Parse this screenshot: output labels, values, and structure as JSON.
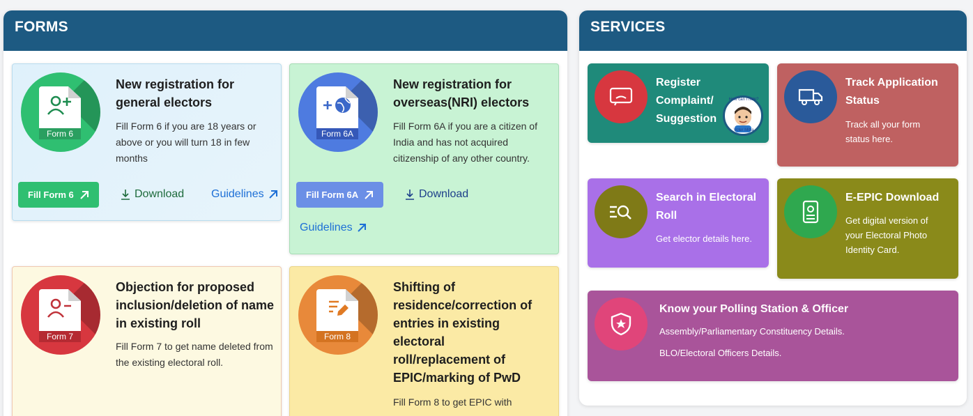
{
  "forms": {
    "header": "FORMS",
    "cards": [
      {
        "form_label": "Form 6",
        "title": "New registration for general electors",
        "desc": "Fill Form 6 if you are 18 years or above or you will turn 18 in few months",
        "button": "Fill Form 6",
        "download": "Download",
        "guidelines": "Guidelines",
        "color": "#2fbf71"
      },
      {
        "form_label": "Form 6A",
        "title": "New registration for overseas(NRI) electors",
        "desc": "Fill Form 6A if you are a citizen of India and has not acquired citizenship of any other country.",
        "button": "Fill Form 6A",
        "download": "Download",
        "guidelines": "Guidelines",
        "color": "#6b8fe6"
      },
      {
        "form_label": "Form 7",
        "title": "Objection for proposed inclusion/deletion of name in existing roll",
        "desc": "Fill Form 7 to get name deleted from the existing electoral roll.",
        "color": "#d7373f"
      },
      {
        "form_label": "Form 8",
        "title": "Shifting of residence/correction of entries in existing electoral roll/replacement of EPIC/marking of PwD",
        "desc": "Fill Form 8 to get EPIC with",
        "color": "#e8893a"
      }
    ]
  },
  "services": {
    "header": "SERVICES",
    "cards": [
      {
        "title": "Register Complaint/ Suggestion",
        "icon": "complaint-icon",
        "bg": "#1f8a7a",
        "circle": "#d7373f"
      },
      {
        "title": "Track Application Status",
        "desc": "Track all your form status here.",
        "icon": "truck-icon",
        "bg": "#bf6161",
        "circle": "#2a5a9a"
      },
      {
        "title": "Search in Electoral Roll",
        "desc": "Get elector details here.",
        "icon": "search-list-icon",
        "bg": "#a970e8",
        "circle": "#7f7a17"
      },
      {
        "title": "E-EPIC Download",
        "desc": "Get digital version of your Electoral Photo Identity Card.",
        "icon": "id-card-icon",
        "bg": "#8a8a1a",
        "circle": "#2fa84f"
      },
      {
        "title": "Know your Polling Station & Officer",
        "desc1": "Assembly/Parliamentary Constituency Details.",
        "desc2": "BLO/Electoral Officers Details.",
        "icon": "shield-star-icon",
        "bg": "#a9549a",
        "circle": "#e0457a"
      }
    ],
    "mascot": {
      "top_text": "How can I help?",
      "bottom_text": "Voter Mitra"
    }
  }
}
